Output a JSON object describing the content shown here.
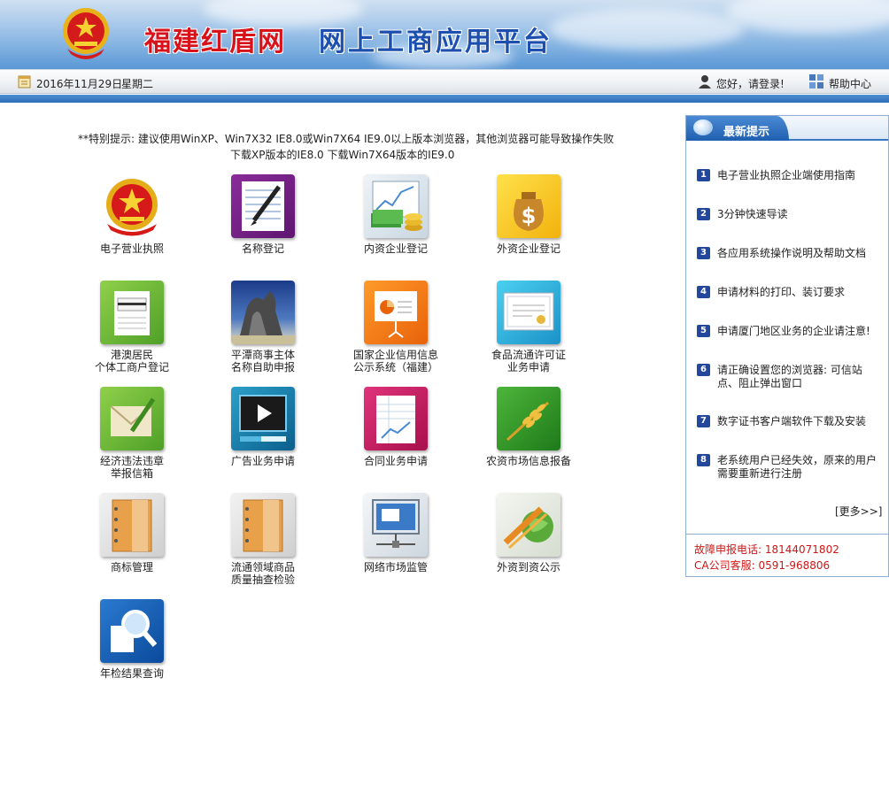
{
  "header": {
    "site_name": "福建红盾网",
    "platform_name": "网上工商应用平台"
  },
  "status_bar": {
    "date": "2016年11月29日",
    "weekday": "星期二",
    "login_text": "您好，请登录!",
    "help_text": "帮助中心"
  },
  "notice": {
    "line1": "**特别提示: 建议使用WinXP、Win7X32 IE8.0或Win7X64 IE9.0以上版本浏览器，其他浏览器可能导致操作失败",
    "download_xp": "下载XP版本的IE8.0",
    "download_win7": "下载Win7X64版本的IE9.0"
  },
  "apps": [
    {
      "label": "电子营业执照",
      "icon": "national-emblem-icon"
    },
    {
      "label": "名称登记",
      "icon": "notebook-pen-icon"
    },
    {
      "label": "内资企业登记",
      "icon": "chart-money-icon"
    },
    {
      "label": "外资企业登记",
      "icon": "dollar-bag-icon"
    },
    {
      "label": "港澳居民\n个体工商户登记",
      "icon": "receipt-card-icon"
    },
    {
      "label": "平潭商事主体\n名称自助申报",
      "icon": "rock-landscape-icon"
    },
    {
      "label": "国家企业信用信息\n公示系统（福建）",
      "icon": "presentation-board-icon"
    },
    {
      "label": "食品流通许可证\n业务申请",
      "icon": "certificate-icon"
    },
    {
      "label": "经济违法违章\n举报信箱",
      "icon": "envelope-pencil-icon"
    },
    {
      "label": "广告业务申请",
      "icon": "video-player-icon"
    },
    {
      "label": "合同业务申请",
      "icon": "spreadsheet-chart-icon"
    },
    {
      "label": "农资市场信息报备",
      "icon": "wheat-icon"
    },
    {
      "label": "商标管理",
      "icon": "orange-binder-icon"
    },
    {
      "label": "流通领域商品\n质量抽查检验",
      "icon": "orange-binder-icon"
    },
    {
      "label": "网络市场监管",
      "icon": "network-monitor-icon"
    },
    {
      "label": "外资到资公示",
      "icon": "globe-ribbon-icon"
    },
    {
      "label": "年检结果查询",
      "icon": "magnifier-icon"
    }
  ],
  "panel": {
    "title": "最新提示",
    "tips": [
      {
        "num": "1",
        "text": "电子营业执照企业端使用指南"
      },
      {
        "num": "2",
        "text": "3分钟快速导读"
      },
      {
        "num": "3",
        "text": "各应用系统操作说明及帮助文档"
      },
      {
        "num": "4",
        "text": "申请材料的打印、装订要求"
      },
      {
        "num": "5",
        "text": "申请厦门地区业务的企业请注意!"
      },
      {
        "num": "6",
        "text": "请正确设置您的浏览器: 可信站点、阻止弹出窗口"
      },
      {
        "num": "7",
        "text": "数字证书客户端软件下载及安装"
      },
      {
        "num": "8",
        "text": "老系统用户已经失效，原来的用户需要重新进行注册"
      }
    ],
    "more": "[更多>>]",
    "hotline": "故障申报电话: 18144071802",
    "ca_service": "CA公司客服: 0591-968806"
  },
  "colors": {
    "brand_red": "#d8121a",
    "brand_blue": "#1d4fae",
    "tip_badge": "#23479c",
    "hotline_red": "#d21515"
  }
}
